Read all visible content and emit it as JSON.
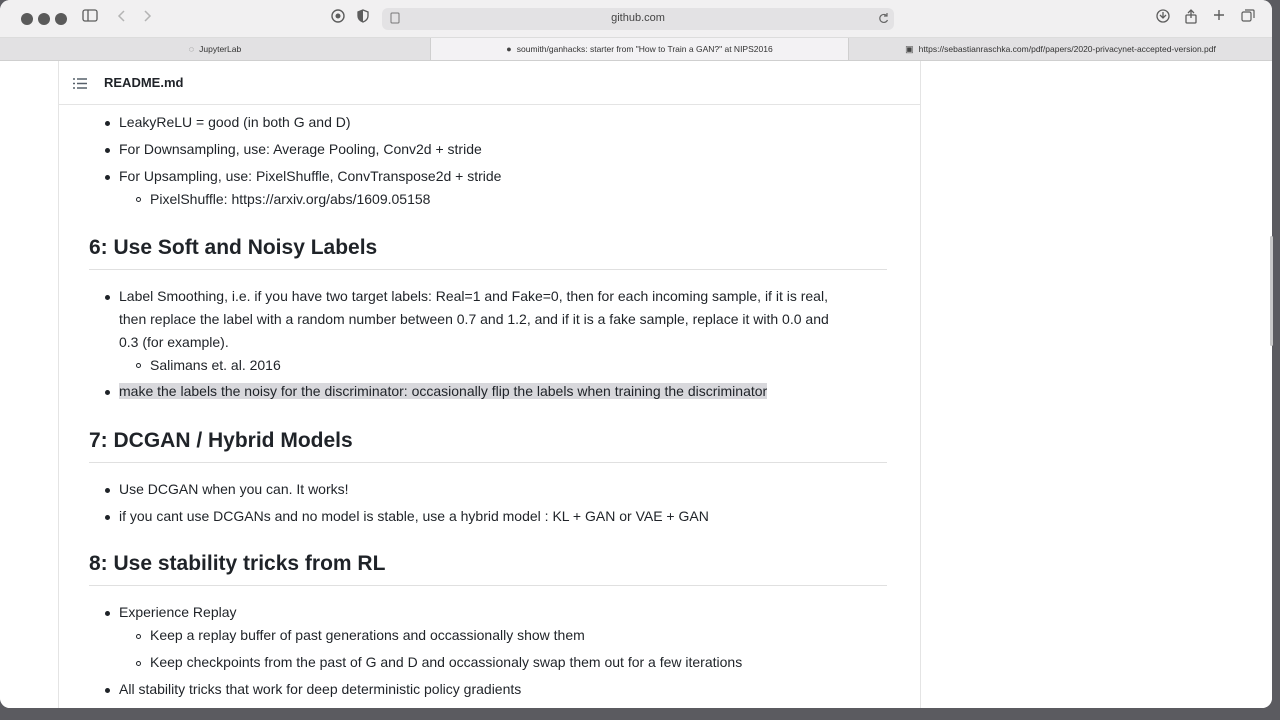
{
  "browser": {
    "address": "github.com",
    "tabs": [
      {
        "label": "JupyterLab",
        "icon": "jupyter-icon"
      },
      {
        "label": "soumith/ganhacks: starter from \"How to Train a GAN?\" at NIPS2016",
        "icon": "github-icon"
      },
      {
        "label": "https://sebastianraschka.com/pdf/papers/2020-privacynet-accepted-version.pdf",
        "icon": "pdf-icon"
      }
    ]
  },
  "readme": {
    "title": "README.md",
    "top_list": [
      "LeakyReLU = good (in both G and D)",
      "For Downsampling, use: Average Pooling, Conv2d + stride",
      "For Upsampling, use: PixelShuffle, ConvTranspose2d + stride"
    ],
    "top_sub": {
      "label": "PixelShuffle: ",
      "link": "https://arxiv.org/abs/1609.05158"
    },
    "sec6": {
      "heading": "6: Use Soft and Noisy Labels",
      "item1_lines": [
        "Label Smoothing, i.e. if you have two target labels: Real=1 and Fake=0, then for each incoming sample, if it is real,",
        "then replace the label with a random number between 0.7 and 1.2, and if it is a fake sample, replace it with 0.0 and",
        "0.3 (for example)."
      ],
      "item1_sub": "Salimans et. al. 2016",
      "item2": "make the labels the noisy for the discriminator: occasionally flip the labels when training the discriminator"
    },
    "sec7": {
      "heading": "7: DCGAN / Hybrid Models",
      "items": [
        "Use DCGAN when you can. It works!",
        "if you cant use DCGANs and no model is stable, use a hybrid model : KL + GAN or VAE + GAN"
      ]
    },
    "sec8": {
      "heading": "8: Use stability tricks from RL",
      "item1": "Experience Replay",
      "item1_subs": [
        "Keep a replay buffer of past generations and occassionally show them",
        "Keep checkpoints from the past of G and D and occassionaly swap them out for a few iterations"
      ],
      "item2": "All stability tricks that work for deep deterministic policy gradients"
    }
  }
}
